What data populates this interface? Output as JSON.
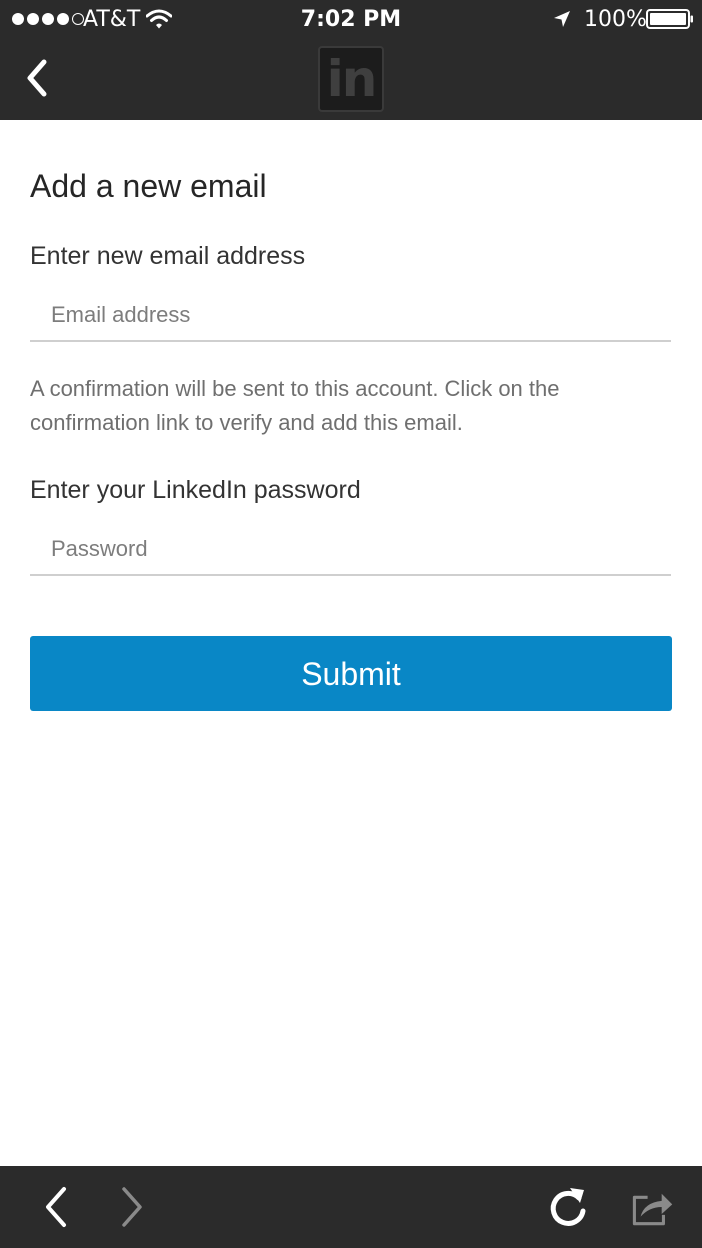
{
  "status_bar": {
    "carrier": "AT&T",
    "time": "7:02 PM",
    "battery": "100%",
    "icons": [
      "signal-dots-icon",
      "wifi-icon",
      "location-arrow-icon",
      "battery-icon"
    ]
  },
  "nav": {
    "back_icon": "chevron-left-icon",
    "logo_text": "in"
  },
  "form": {
    "title": "Add a new email",
    "email_label": "Enter new email address",
    "email_value": "",
    "email_placeholder": "Email address",
    "helper_text": "A confirmation will be sent to this account. Click on the confirmation link to verify and add this email.",
    "password_label": "Enter your LinkedIn password",
    "password_value": "",
    "password_placeholder": "Password",
    "submit_label": "Submit"
  },
  "toolbar": {
    "icons": [
      "back-arrow-icon",
      "forward-arrow-icon",
      "reload-icon",
      "share-icon"
    ]
  },
  "colors": {
    "chrome": "#2b2b2b",
    "accent": "#0987c6",
    "divider": "#cfcfcf"
  }
}
